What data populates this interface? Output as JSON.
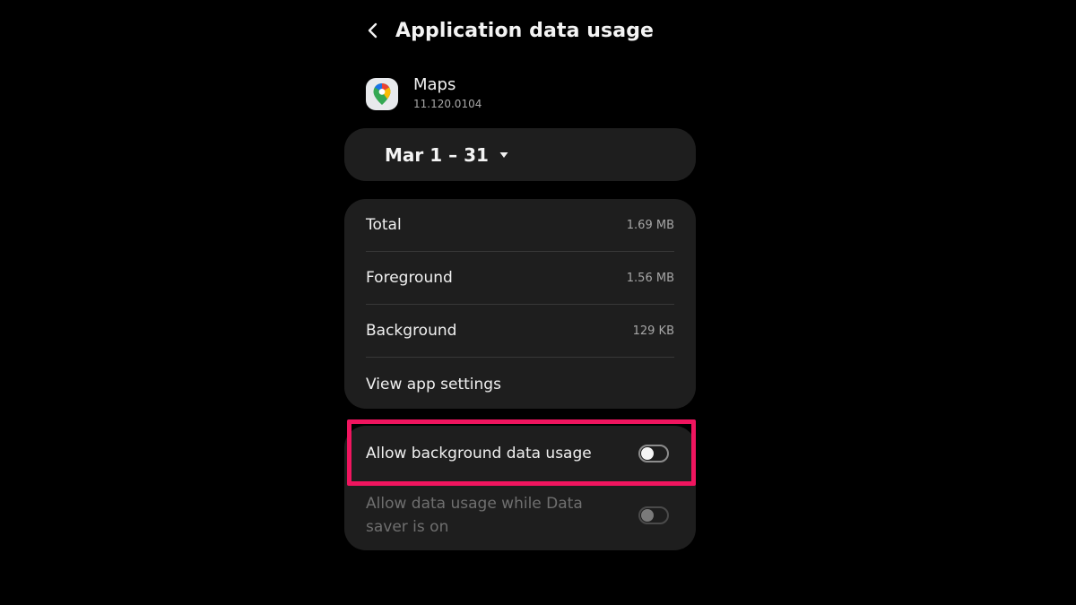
{
  "header": {
    "title": "Application data usage",
    "back_icon": "chevron-left-icon"
  },
  "app": {
    "name": "Maps",
    "version": "11.120.0104",
    "icon": "google-maps-pin-icon"
  },
  "date_range": {
    "label": "Mar 1 – 31",
    "dropdown_icon": "triangle-down-icon"
  },
  "usage": {
    "rows": [
      {
        "label": "Total",
        "value": "1.69 MB"
      },
      {
        "label": "Foreground",
        "value": "1.56 MB"
      },
      {
        "label": "Background",
        "value": "129 KB"
      },
      {
        "label": "View app settings",
        "value": ""
      }
    ]
  },
  "toggles": {
    "background_data": {
      "label": "Allow background data usage",
      "enabled": false
    },
    "data_saver": {
      "label": "Allow data usage while Data saver is on",
      "enabled": false,
      "disabled": true
    }
  },
  "colors": {
    "background": "#000000",
    "card": "#1e1e1e",
    "highlight": "#f0155f",
    "divider": "#383838"
  }
}
